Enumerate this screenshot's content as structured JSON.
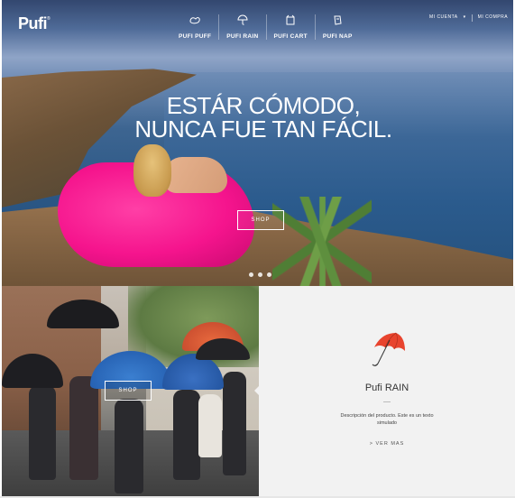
{
  "brand": {
    "logo": "Pufi",
    "trademark": "®"
  },
  "nav": {
    "items": [
      {
        "label": "PUFI PUFF",
        "icon": "puff-icon"
      },
      {
        "label": "PUFI RAIN",
        "icon": "umbrella-icon"
      },
      {
        "label": "PUFI CART",
        "icon": "cart-icon"
      },
      {
        "label": "PUFI NAP",
        "icon": "nap-icon"
      }
    ]
  },
  "account": {
    "my_account": "MI CUENTA",
    "my_purchase": "MI COMPRA"
  },
  "hero": {
    "headline_line1": "ESTÁR CÓMODO,",
    "headline_line2": "NUNCA FUE TAN FÁCIL.",
    "shop_label": "SHOP",
    "slides": 3,
    "active_slide": 1
  },
  "rain_banner": {
    "shop_label": "SHOP"
  },
  "product": {
    "title": "Pufi RAIN",
    "description": "Descripción del producto. Este es un texto simulado",
    "more_label": "> VER MAS"
  },
  "colors": {
    "accent_pink": "#f5148d",
    "umbrella_red": "#e8442e",
    "panel_bg": "#f2f2f2"
  }
}
